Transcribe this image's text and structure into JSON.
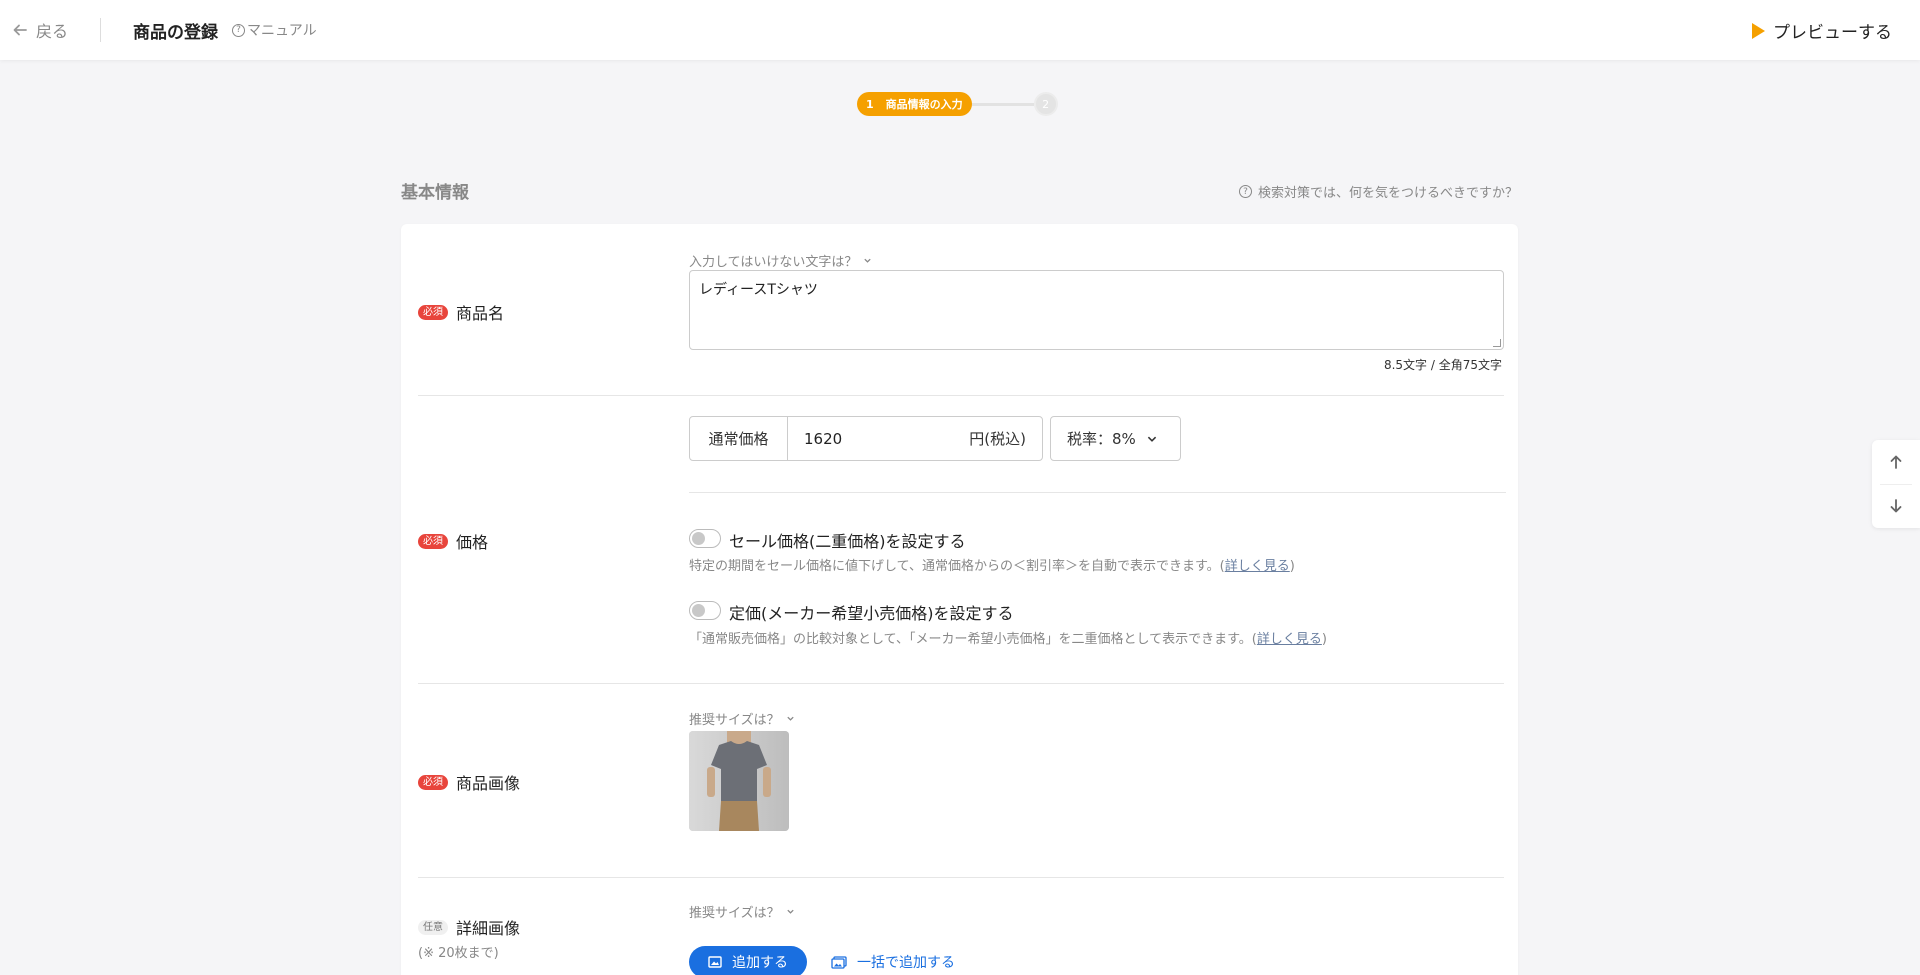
{
  "header": {
    "back_label": "戻る",
    "title": "商品の登録",
    "manual_label": "マニュアル",
    "preview_label": "プレビューする"
  },
  "stepper": {
    "step1_number": "1",
    "step1_label": "商品情報の入力",
    "step2_number": "2"
  },
  "section": {
    "title": "基本情報",
    "seo_help": "検索対策では、何を気をつけるべきですか？"
  },
  "badges": {
    "required": "必須",
    "optional": "任意"
  },
  "product_name": {
    "label": "商品名",
    "help": "入力してはいけない文字は？",
    "value": "レディースTシャツ",
    "counter": "8.5文字 / 全角75文字"
  },
  "price": {
    "label": "価格",
    "prefix": "通常価格",
    "value": "1620",
    "suffix": "円(税込)",
    "tax_rate": "税率：8%",
    "sale_toggle_label": "セール価格(二重価格)を設定する",
    "sale_desc": "特定の期間をセール価格に値下げして、通常価格からの＜割引率＞を自動で表示できます。(",
    "sale_link": "詳しく見る",
    "list_toggle_label": "定価(メーカー希望小売価格)を設定する",
    "list_desc": "「通常販売価格」の比較対象として、「メーカー希望小売価格」を二重価格として表示できます。(",
    "list_link": "詳しく見る",
    "close_paren": ")",
    "sale_enabled": false,
    "list_enabled": false
  },
  "product_image": {
    "label": "商品画像",
    "help": "推奨サイズは？"
  },
  "detail_image": {
    "label": "詳細画像",
    "note": "(※ 20枚まで)",
    "help": "推奨サイズは？",
    "add_button": "追加する",
    "bulk_add": "一括で追加する"
  },
  "colors": {
    "accent_orange": "#f5a000",
    "required_red": "#e8453c",
    "primary_blue": "#1a6fe0"
  }
}
